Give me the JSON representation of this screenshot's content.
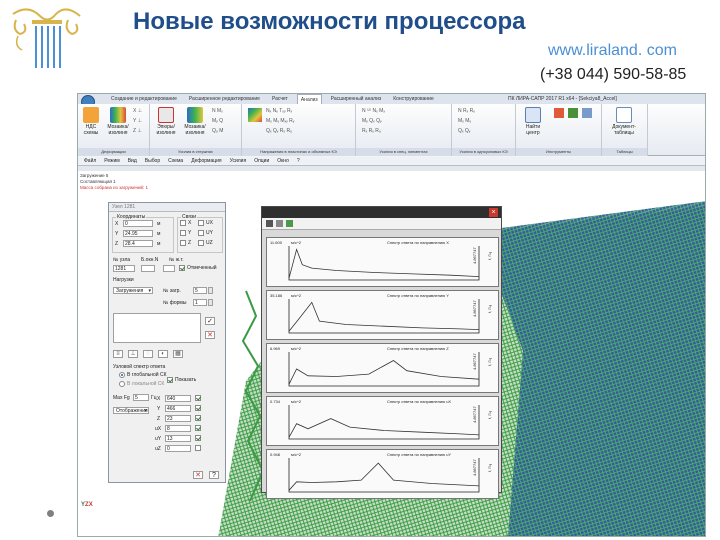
{
  "slide": {
    "title": "Новые возможности процессора",
    "link": "www.liraland. com",
    "phone": "(+38 044) 590-58-85"
  },
  "window": {
    "tabs": [
      "Создание и редактирование",
      "Расширенное редактирование",
      "Расчет",
      "Анализ",
      "Расширенный анализ",
      "Конструирование"
    ],
    "active_tab": "Анализ",
    "title": "ПК ЛИРА-САПР  2017 R1 x64 - [Sekciya8_Accel]"
  },
  "ribbon": {
    "groups": [
      {
        "label": "Деформации",
        "buttons": [
          "НДС схемы",
          "Мозаика/изолиня"
        ]
      },
      {
        "label": "Усилия в стержнях",
        "buttons": [
          "Эпюры/изолиня",
          "Мозаика/изолиня"
        ]
      },
      {
        "label": "Напряжения в пластинах и объемных КЭ",
        "buttons": []
      },
      {
        "label": "Усилия в спец. элементах",
        "buttons": []
      },
      {
        "label": "Усилия в одноузловых КЭ",
        "buttons": []
      },
      {
        "label": "Инструменты",
        "buttons": [
          "Найти центр"
        ]
      },
      {
        "label": "Таблицы",
        "buttons": [
          "Документ-таблицы"
        ]
      }
    ]
  },
  "menu": [
    "Файл",
    "Режим",
    "Вид",
    "Выбор",
    "Схема",
    "Деформация",
    "Усилия",
    "Опции",
    "Окно",
    "?"
  ],
  "info": {
    "line1": "Загружение 5",
    "line2": "Составляющая 1",
    "line3": "Масса собрана из загружений: 1"
  },
  "node_panel": {
    "title": "Узел 1281",
    "coords_title": "Координаты",
    "links_title": "Связи",
    "x_label": "X",
    "x_value": "0",
    "x_unit": "м",
    "y_label": "Y",
    "y_value": "24.95",
    "y_unit": "м",
    "z_label": "Z",
    "z_value": "28.4",
    "z_unit": "м",
    "links": [
      "X",
      "UX",
      "Y",
      "UY",
      "Z",
      "UZ"
    ],
    "node_no_label": "№ узла",
    "node_no": "1281",
    "loc_label": "Б.окн.N",
    "nzh_label": "№ ж.т.",
    "marked_label": "Отмеченный",
    "loads_title": "Нагрузки",
    "load_select": "Загружения",
    "load_no_label": "№ загр.",
    "load_no": "5",
    "form_no_label": "№ формы",
    "form_no": "1",
    "spectrum_title": "Узловой спектр ответа",
    "global_cs": "В глобальной СК",
    "local_cs": "В локальной СК",
    "show_label": "Показать",
    "max_fg_label": "Max Fg",
    "max_fg_value": "5",
    "max_fg_unit": "Гц",
    "mode_select": "Отображение",
    "dirs": [
      {
        "label": "X",
        "value": "640"
      },
      {
        "label": "Y",
        "value": "466"
      },
      {
        "label": "Z",
        "value": "23"
      },
      {
        "label": "uX",
        "value": "8"
      },
      {
        "label": "uY",
        "value": "13"
      },
      {
        "label": "uZ",
        "value": "0"
      }
    ]
  },
  "spectra": [
    {
      "peak": "11.600",
      "unit": "м/с^2",
      "title": "Спектр ответа по направлению X",
      "end": "4.867747"
    },
    {
      "peak": "35.186",
      "unit": "м/с^2",
      "title": "Спектр ответа по направлению Y",
      "end": "4.867747"
    },
    {
      "peak": "6.969",
      "unit": "м/с^2",
      "title": "Спектр ответа по направлению Z",
      "end": "4.867747"
    },
    {
      "peak": "0.734",
      "unit": "м/с^2",
      "title": "Спектр ответа по направлению uX",
      "end": "4.867747"
    },
    {
      "peak": "0.948",
      "unit": "м/с^2",
      "title": "Спектр ответа по направлению uY",
      "end": "4.867747"
    }
  ],
  "freq_label": "f, Гц"
}
